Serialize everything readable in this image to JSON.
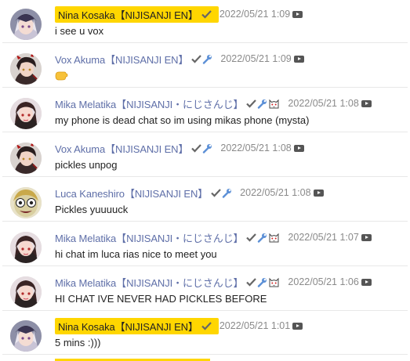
{
  "messages": [
    {
      "author": "Nina Kosaka【NIJISANJI EN】",
      "owner": true,
      "badges": [
        "check"
      ],
      "time": "2022/05/21 1:09",
      "text": "i see u vox",
      "avatar": "nina"
    },
    {
      "author": "Vox Akuma【NIJISANJI EN】",
      "owner": false,
      "badges": [
        "check",
        "wrench"
      ],
      "time": "2022/05/21 1:09",
      "text": "",
      "emoji": "hand-emoji",
      "avatar": "vox"
    },
    {
      "author": "Mika Melatika【NIJISANJI・にじさんじ】",
      "owner": false,
      "badges": [
        "check",
        "wrench",
        "cat"
      ],
      "time": "2022/05/21 1:08",
      "text": "my phone is dead chat so im using mikas phone (mysta)",
      "avatar": "mika"
    },
    {
      "author": "Vox Akuma【NIJISANJI EN】",
      "owner": false,
      "badges": [
        "check",
        "wrench"
      ],
      "time": "2022/05/21 1:08",
      "text": "pickles unpog",
      "avatar": "vox"
    },
    {
      "author": "Luca Kaneshiro【NIJISANJI EN】",
      "owner": false,
      "badges": [
        "check",
        "wrench"
      ],
      "time": "2022/05/21 1:08",
      "text": "Pickles yuuuuck",
      "avatar": "luca"
    },
    {
      "author": "Mika Melatika【NIJISANJI・にじさんじ】",
      "owner": false,
      "badges": [
        "check",
        "wrench",
        "cat"
      ],
      "time": "2022/05/21 1:07",
      "text": "hi chat im luca rias nice to meet you",
      "avatar": "mika"
    },
    {
      "author": "Mika Melatika【NIJISANJI・にじさんじ】",
      "owner": false,
      "badges": [
        "check",
        "wrench",
        "cat"
      ],
      "time": "2022/05/21 1:06",
      "text": "HI CHAT IVE NEVER HAD PICKLES BEFORE",
      "avatar": "mika"
    },
    {
      "author": "Nina Kosaka【NIJISANJI EN】",
      "owner": true,
      "badges": [
        "check"
      ],
      "time": "2022/05/21 1:01",
      "text": "5 mins :)))",
      "avatar": "nina"
    }
  ],
  "colors": {
    "owner_highlight": "#ffd600",
    "author_name": "#5f6fa8",
    "timestamp": "#8a8a8a",
    "badge": "#666666",
    "wrench": "#5b8fd6"
  }
}
